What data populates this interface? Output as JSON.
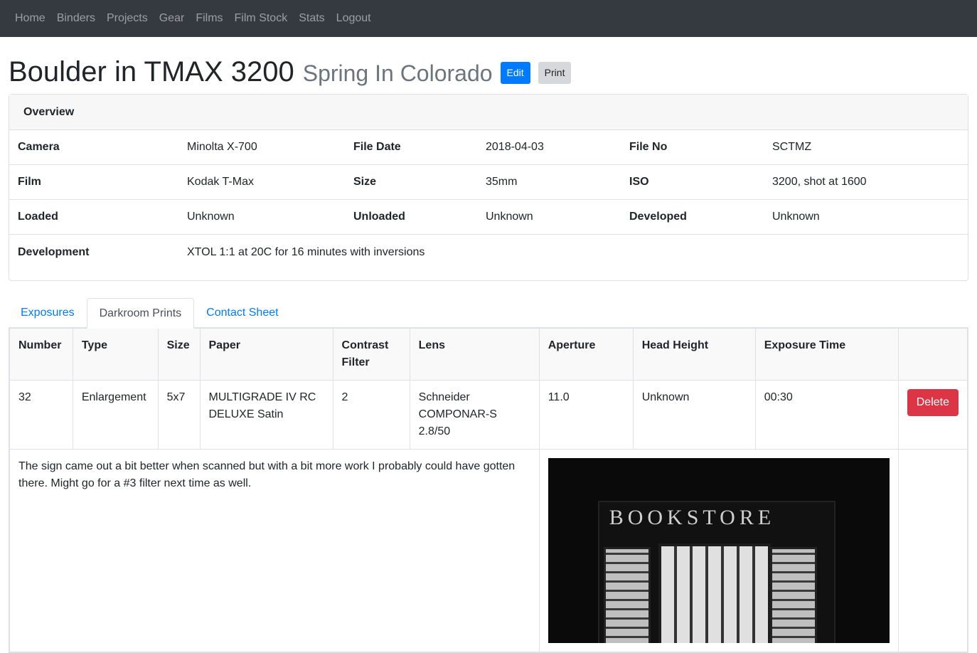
{
  "nav": [
    "Home",
    "Binders",
    "Projects",
    "Gear",
    "Films",
    "Film Stock",
    "Stats",
    "Logout"
  ],
  "page": {
    "title": "Boulder in TMAX 3200",
    "subtitle": "Spring In Colorado",
    "edit_label": "Edit",
    "print_label": "Print"
  },
  "overview": {
    "header": "Overview",
    "rows": [
      [
        {
          "label": "Camera",
          "value": "Minolta X-700"
        },
        {
          "label": "File Date",
          "value": "2018-04-03"
        },
        {
          "label": "File No",
          "value": "SCTMZ"
        }
      ],
      [
        {
          "label": "Film",
          "value": "Kodak T-Max"
        },
        {
          "label": "Size",
          "value": "35mm"
        },
        {
          "label": "ISO",
          "value": "3200, shot at 1600"
        }
      ],
      [
        {
          "label": "Loaded",
          "value": "Unknown"
        },
        {
          "label": "Unloaded",
          "value": "Unknown"
        },
        {
          "label": "Developed",
          "value": "Unknown"
        }
      ]
    ],
    "development": {
      "label": "Development",
      "value": "XTOL 1:1 at 20C for 16 minutes with inversions"
    }
  },
  "tabs": [
    "Exposures",
    "Darkroom Prints",
    "Contact Sheet"
  ],
  "prints": {
    "columns": [
      "Number",
      "Type",
      "Size",
      "Paper",
      "Contrast Filter",
      "Lens",
      "Aperture",
      "Head Height",
      "Exposure Time"
    ],
    "row": [
      "32",
      "Enlargement",
      "5x7",
      "MULTIGRADE IV RC DELUXE Satin",
      "2",
      "Schneider COMPONAR-S 2.8/50",
      "11.0",
      "Unknown",
      "00:30"
    ],
    "delete_label": "Delete",
    "notes": "The sign came out a bit better when scanned but with a bit more work I probably could have gotten there. Might go for a #3 filter next time as well.",
    "photo_sign": "BOOKSTORE"
  }
}
